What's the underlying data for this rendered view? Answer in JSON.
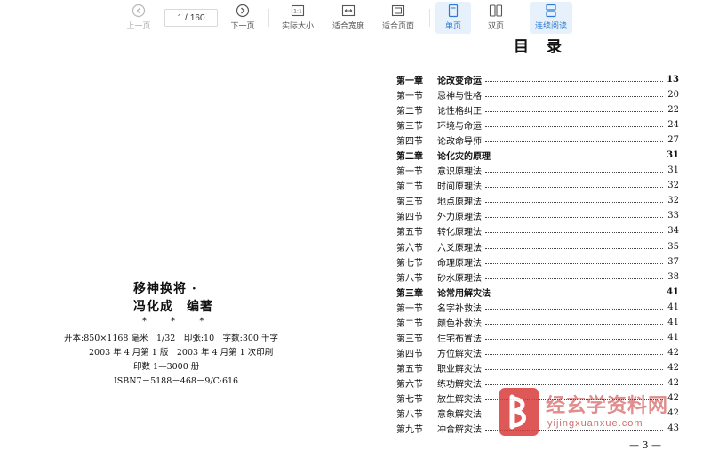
{
  "toolbar": {
    "prev_label": "上一页",
    "page_current": "1",
    "page_sep": "/",
    "page_total": "160",
    "next_label": "下一页",
    "actual_size_label": "实际大小",
    "fit_width_label": "适合宽度",
    "fit_page_label": "适合页面",
    "single_page_label": "单页",
    "double_page_label": "双页",
    "continuous_label": "连续阅读",
    "actual_size_icon_text": "1:1"
  },
  "left_page": {
    "title": "移神换将 ·",
    "author": "冯化成　编著",
    "stars": "* * *",
    "line1": "开本:850×1168 毫米　1/32　印张:10　字数:300 千字",
    "line2": "2003 年 4 月第 1 版　2003 年 4 月第 1 次印刷",
    "line3": "印数 1—3000 册",
    "line4": "ISBN7－5188－468－9/C·616"
  },
  "toc": {
    "title": "目录",
    "entries": [
      {
        "sec": "第一章",
        "name": "论改变命运",
        "page": "13",
        "chapter": true
      },
      {
        "sec": "第一节",
        "name": "忌神与性格",
        "page": "20"
      },
      {
        "sec": "第二节",
        "name": "论性格纠正",
        "page": "22"
      },
      {
        "sec": "第三节",
        "name": "环境与命运",
        "page": "24"
      },
      {
        "sec": "第四节",
        "name": "论改命导师",
        "page": "27"
      },
      {
        "sec": "第二章",
        "name": "论化灾的原理",
        "page": "31",
        "chapter": true
      },
      {
        "sec": "第一节",
        "name": "意识原理法",
        "page": "31"
      },
      {
        "sec": "第二节",
        "name": "时间原理法",
        "page": "32"
      },
      {
        "sec": "第三节",
        "name": "地点原理法",
        "page": "32"
      },
      {
        "sec": "第四节",
        "name": "外力原理法",
        "page": "33"
      },
      {
        "sec": "第五节",
        "name": "转化原理法",
        "page": "34"
      },
      {
        "sec": "第六节",
        "name": "六爻原理法",
        "page": "35"
      },
      {
        "sec": "第七节",
        "name": "命理原理法",
        "page": "37"
      },
      {
        "sec": "第八节",
        "name": "砂水原理法",
        "page": "38"
      },
      {
        "sec": "第三章",
        "name": "论常用解灾法",
        "page": "41",
        "chapter": true
      },
      {
        "sec": "第一节",
        "name": "名字补救法",
        "page": "41"
      },
      {
        "sec": "第二节",
        "name": "颜色补救法",
        "page": "41"
      },
      {
        "sec": "第三节",
        "name": "住宅布置法",
        "page": "41"
      },
      {
        "sec": "第四节",
        "name": "方位解灾法",
        "page": "42"
      },
      {
        "sec": "第五节",
        "name": "职业解灾法",
        "page": "42"
      },
      {
        "sec": "第六节",
        "name": "练功解灾法",
        "page": "42"
      },
      {
        "sec": "第七节",
        "name": "放生解灾法",
        "page": "42"
      },
      {
        "sec": "第八节",
        "name": "意象解灾法",
        "page": "42"
      },
      {
        "sec": "第九节",
        "name": "冲合解灾法",
        "page": "43"
      }
    ],
    "page_number": "— 3 —"
  },
  "watermark": {
    "text": "经玄学资料网",
    "url": "yijingxuanxue.com"
  },
  "colors": {
    "accent": "#2d79d3",
    "active_bg": "#e7f1fb",
    "watermark_red": "#c93131"
  }
}
